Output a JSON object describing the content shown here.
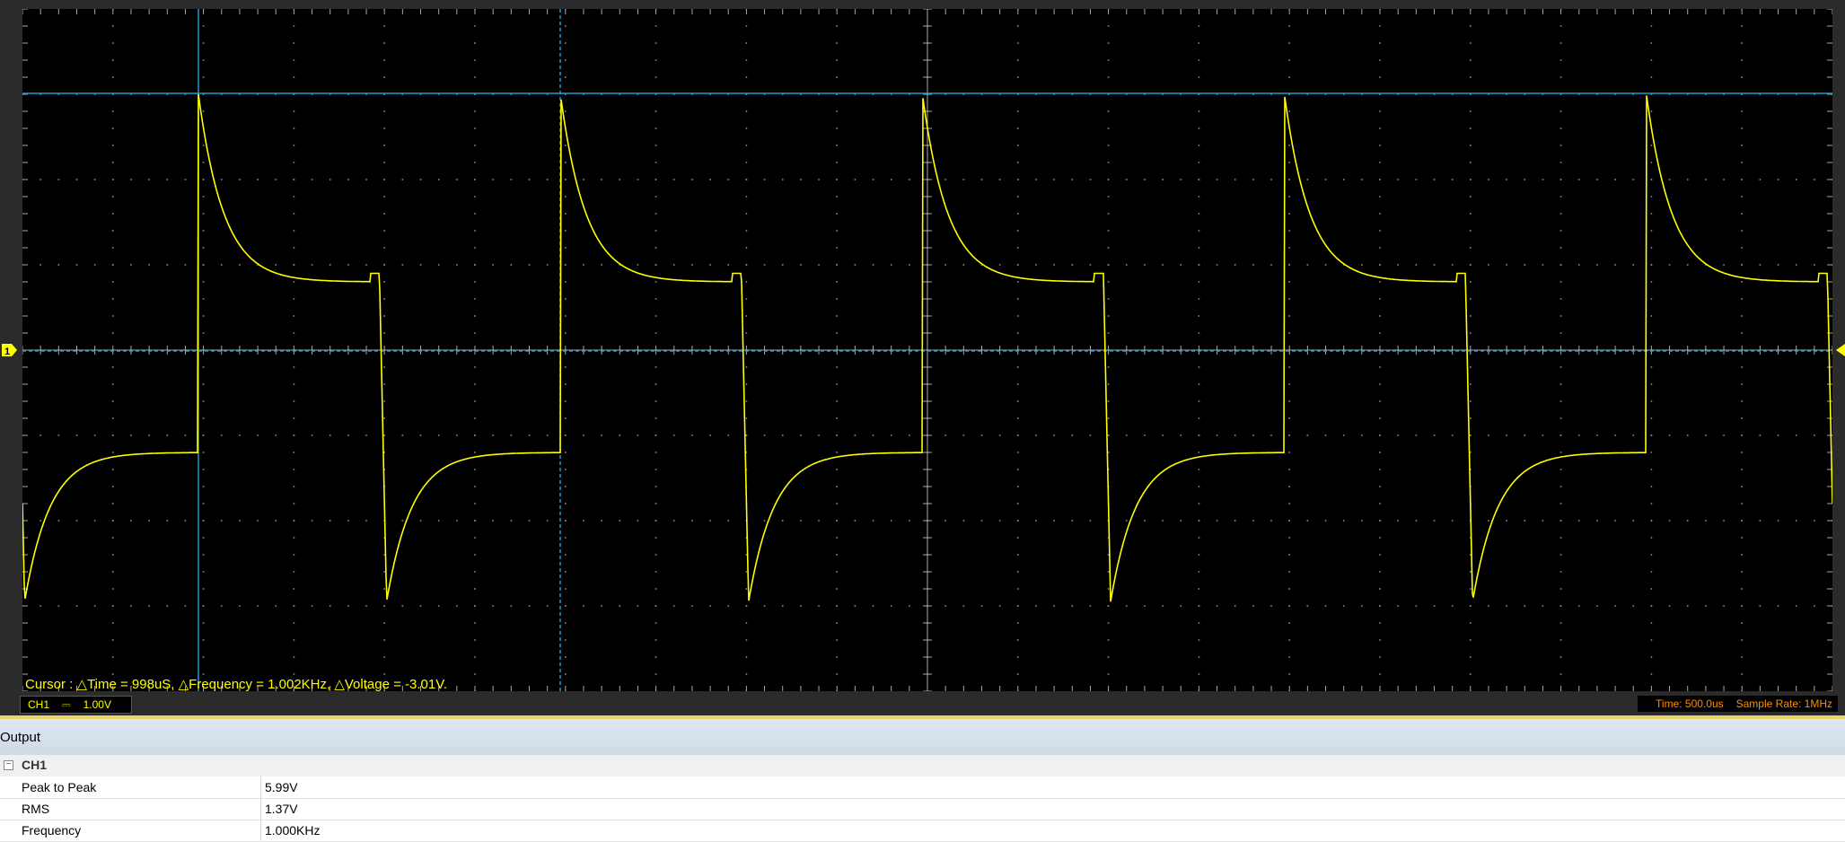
{
  "scope": {
    "cursor_readout": "Cursor : △Time = 998uS, △Frequency = 1.002KHz, △Voltage = -3.01V.",
    "channel_marker": "1",
    "colors": {
      "trace": "#ffff00",
      "cursor": "#1f9bcf",
      "grid": "#8a8a8a",
      "background": "#000000",
      "status": "#ff8c00"
    }
  },
  "status_bar": {
    "channel_label": "CH1",
    "coupling": "⎓",
    "volts_per_div": "1.00V",
    "time_per_div": "Time: 500.0us",
    "sample_rate": "Sample Rate: 1MHz"
  },
  "output": {
    "title": "Output",
    "group": "CH1",
    "collapse_symbol": "−",
    "rows": [
      {
        "name": "Peak to Peak",
        "value": "5.99V"
      },
      {
        "name": "RMS",
        "value": "1.37V"
      },
      {
        "name": "Frequency",
        "value": "1.000KHz"
      }
    ]
  }
}
